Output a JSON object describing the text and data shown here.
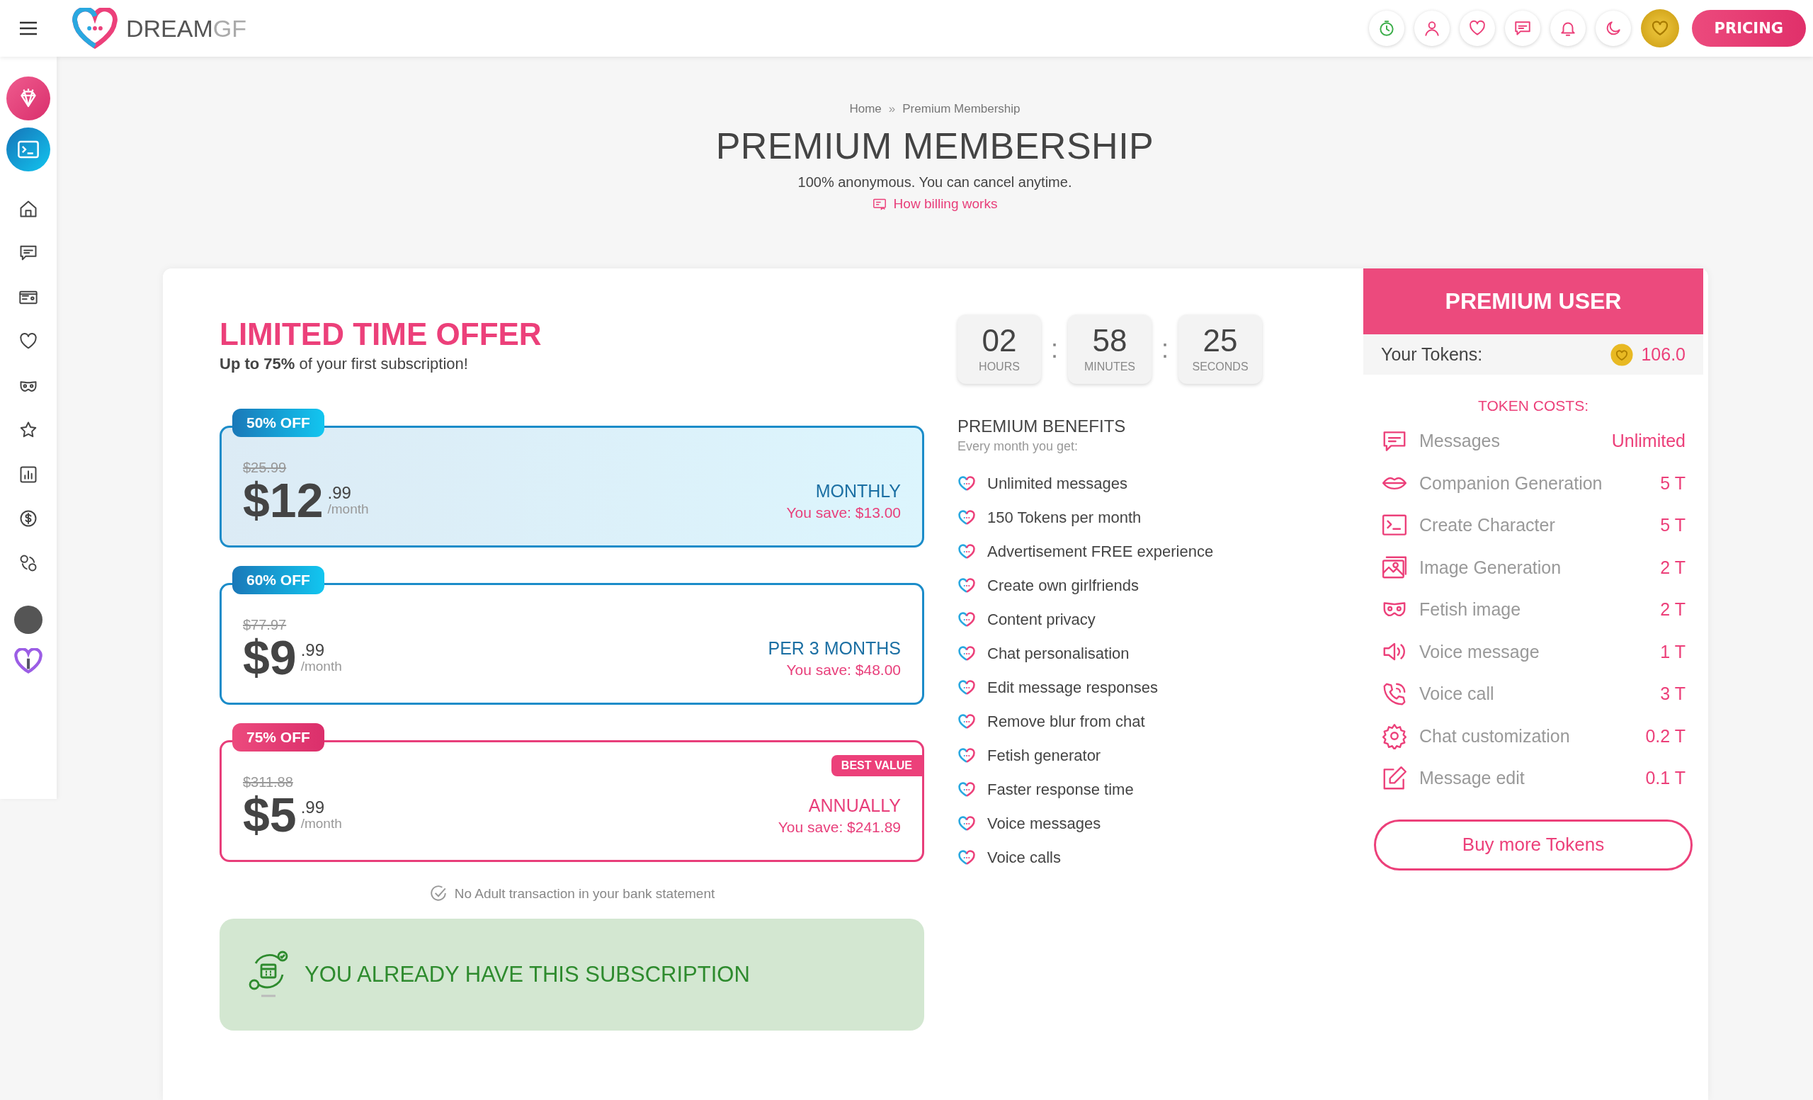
{
  "header": {
    "brand": "DREAM",
    "brand_suffix": "GF",
    "pricing_button": "PRICING"
  },
  "breadcrumb": {
    "home": "Home",
    "separator": "»",
    "current": "Premium Membership"
  },
  "title": "PREMIUM MEMBERSHIP",
  "subtitle": "100% anonymous. You can cancel anytime.",
  "billing_link": "How billing works",
  "offer": {
    "title": "LIMITED TIME OFFER",
    "subtitle": "**Up to 75%** of your first subscription!"
  },
  "plans": [
    {
      "badge": "50% OFF",
      "old_price": "$25.99",
      "dollars": "$12",
      "cents": ".99",
      "per": "/month",
      "period": "MONTHLY",
      "save": "You save: $13.00",
      "kind": "standard",
      "selected": true
    },
    {
      "badge": "60% OFF",
      "old_price": "$77.97",
      "dollars": "$9",
      "cents": ".99",
      "per": "/month",
      "period": "PER 3 MONTHS",
      "save": "You save: $48.00",
      "kind": "standard",
      "selected": false
    },
    {
      "badge": "75% OFF",
      "old_price": "$311.88",
      "dollars": "$5",
      "cents": ".99",
      "per": "/month",
      "period": "ANNUALLY",
      "save": "You save: $241.89",
      "kind": "best",
      "best_value": "BEST VALUE",
      "selected": false
    }
  ],
  "bank_note": "No Adult transaction in your bank statement",
  "subscription_notice": "YOU ALREADY HAVE THIS SUBSCRIPTION",
  "timer": [
    {
      "value": "02",
      "label": "HOURS"
    },
    {
      "value": "58",
      "label": "MINUTES"
    },
    {
      "value": "25",
      "label": "SECONDS"
    }
  ],
  "timer_separator": ":",
  "benefits": {
    "title": "PREMIUM BENEFITS",
    "subtitle": "Every month you get:",
    "items": [
      "Unlimited messages",
      "150 Tokens per month",
      "Advertisement FREE experience",
      "Create own girlfriends",
      "Content privacy",
      "Chat personalisation",
      "Edit message responses",
      "Remove blur from chat",
      "Fetish generator",
      "Faster response time",
      "Voice messages",
      "Voice calls"
    ]
  },
  "premium_panel": {
    "title": "PREMIUM USER",
    "tokens_label": "Your Tokens:",
    "tokens_value": "106.0",
    "costs_title": "TOKEN COSTS:",
    "costs": [
      {
        "name": "Messages",
        "value": "Unlimited"
      },
      {
        "name": "Companion Generation",
        "value": "5 T"
      },
      {
        "name": "Create Character",
        "value": "5 T"
      },
      {
        "name": "Image Generation",
        "value": "2 T"
      },
      {
        "name": "Fetish image",
        "value": "2 T"
      },
      {
        "name": "Voice message",
        "value": "1 T"
      },
      {
        "name": "Voice call",
        "value": "3 T"
      },
      {
        "name": "Chat customization",
        "value": "0.2 T"
      },
      {
        "name": "Message edit",
        "value": "0.1 T"
      }
    ],
    "button": "Buy more Tokens"
  }
}
